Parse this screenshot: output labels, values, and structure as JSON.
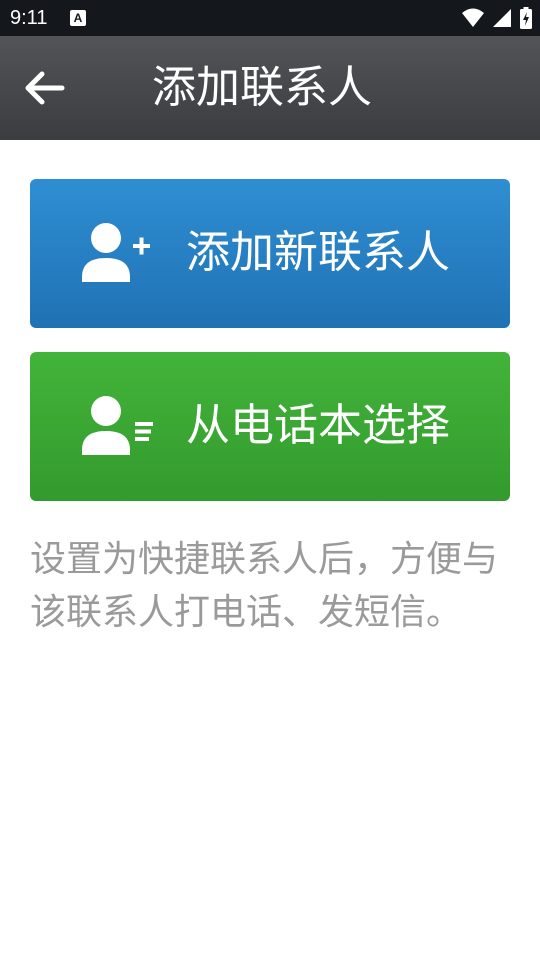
{
  "status_bar": {
    "time": "9:11",
    "notification_icon": "a-notification-icon",
    "icons": [
      "wifi-icon",
      "cellular-signal-icon",
      "battery-charging-icon"
    ]
  },
  "app_bar": {
    "back_icon": "arrow-left-icon",
    "title": "添加联系人"
  },
  "actions": {
    "add_new": {
      "label": "添加新联系人",
      "icon": "person-add-icon",
      "color": "#2a84c8"
    },
    "from_phonebook": {
      "label": "从电话本选择",
      "icon": "person-list-icon",
      "color": "#3cab35"
    }
  },
  "hint": "设置为快捷联系人后，方便与该联系人打电话、发短信。",
  "colors": {
    "status_bar": "#14171b",
    "app_bar": "#47484b",
    "hint_text": "#9a9a9a"
  }
}
